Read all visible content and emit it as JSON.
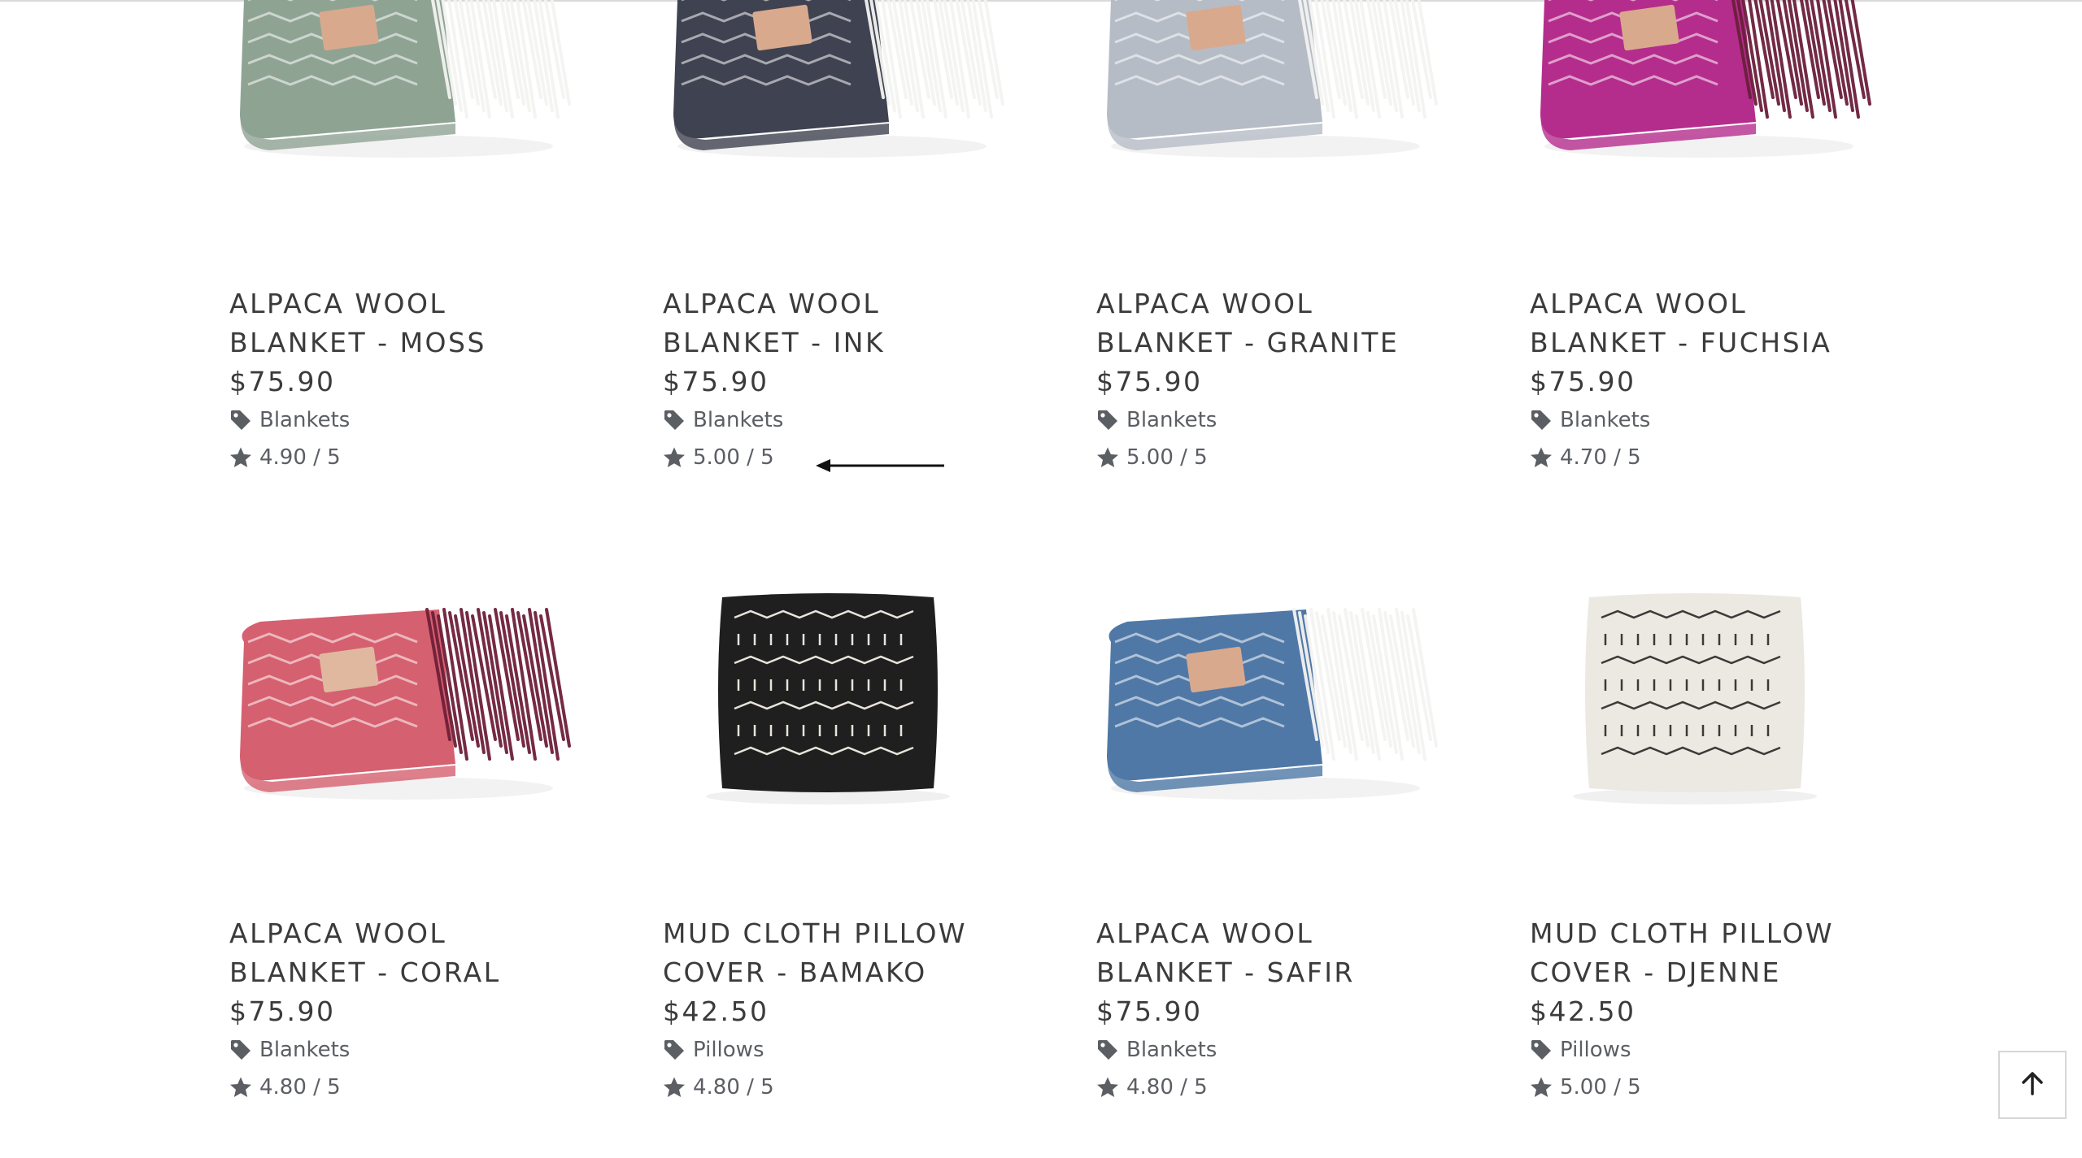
{
  "products": [
    {
      "name_line1": "ALPACA WOOL",
      "name_line2": "BLANKET - MOSS",
      "price": "$75.90",
      "category": "Blankets",
      "rating": "4.90 / 5",
      "category_icon": "tag-icon",
      "rating_icon": "star-icon",
      "image": {
        "kind": "blanket",
        "primary": "#8fa393",
        "fringe": "#f4f4f2",
        "label": "#d9a98e"
      }
    },
    {
      "name_line1": "ALPACA WOOL",
      "name_line2": "BLANKET - INK",
      "price": "$75.90",
      "category": "Blankets",
      "rating": "5.00 / 5",
      "category_icon": "tag-icon",
      "rating_icon": "star-icon",
      "image": {
        "kind": "blanket",
        "primary": "#3f4250",
        "fringe": "#f4f4f2",
        "label": "#d9a98e"
      }
    },
    {
      "name_line1": "ALPACA WOOL",
      "name_line2": "BLANKET - GRANITE",
      "price": "$75.90",
      "category": "Blankets",
      "rating": "5.00 / 5",
      "category_icon": "tag-icon",
      "rating_icon": "star-icon",
      "image": {
        "kind": "blanket",
        "primary": "#b6bcc6",
        "fringe": "#f4f4f2",
        "label": "#d9a98e"
      }
    },
    {
      "name_line1": "ALPACA WOOL",
      "name_line2": "BLANKET - FUCHSIA",
      "price": "$75.90",
      "category": "Blankets",
      "rating": "4.70 / 5",
      "category_icon": "tag-icon",
      "rating_icon": "star-icon",
      "image": {
        "kind": "blanket",
        "primary": "#b52d8c",
        "fringe": "#6b1f3a",
        "label": "#d9a98e"
      }
    },
    {
      "name_line1": "ALPACA WOOL",
      "name_line2": "BLANKET - CORAL",
      "price": "$75.90",
      "category": "Blankets",
      "rating": "4.80 / 5",
      "category_icon": "tag-icon",
      "rating_icon": "star-icon",
      "image": {
        "kind": "blanket",
        "primary": "#d5606f",
        "fringe": "#6e1f39",
        "label": "#e0b8a0"
      }
    },
    {
      "name_line1": "MUD CLOTH PILLOW",
      "name_line2": "COVER - BAMAKO",
      "price": "$42.50",
      "category": "Pillows",
      "rating": "4.80 / 5",
      "category_icon": "tag-icon",
      "rating_icon": "star-icon",
      "image": {
        "kind": "pillow",
        "primary": "#1f1f1f",
        "pattern": "#e8e4da"
      }
    },
    {
      "name_line1": "ALPACA WOOL",
      "name_line2": "BLANKET - SAFIR",
      "price": "$75.90",
      "category": "Blankets",
      "rating": "4.80 / 5",
      "category_icon": "tag-icon",
      "rating_icon": "star-icon",
      "image": {
        "kind": "blanket",
        "primary": "#4f78a6",
        "fringe": "#f4f4f2",
        "label": "#d9a98e"
      }
    },
    {
      "name_line1": "MUD CLOTH PILLOW",
      "name_line2": "COVER - DJENNE",
      "price": "$42.50",
      "category": "Pillows",
      "rating": "5.00 / 5",
      "category_icon": "tag-icon",
      "rating_icon": "star-icon",
      "image": {
        "kind": "pillow",
        "primary": "#ece9e2",
        "pattern": "#3a3a3a"
      }
    }
  ],
  "back_to_top": {
    "icon": "arrow-up-icon"
  },
  "annotation_arrow": {
    "icon": "arrow-left-icon"
  },
  "colors": {
    "text": "#3b3b3b",
    "meta": "#5b5e63",
    "border": "#d6d6d6"
  }
}
